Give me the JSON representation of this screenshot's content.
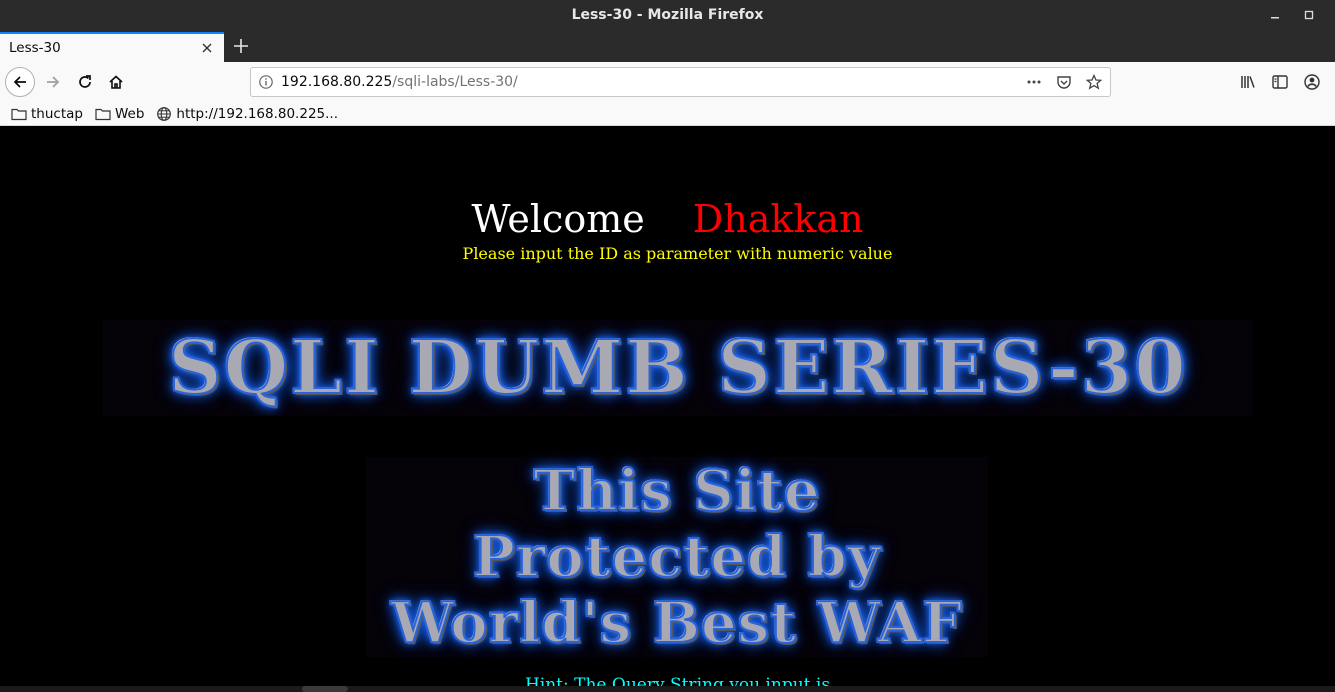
{
  "window": {
    "title": "Less-30 - Mozilla Firefox"
  },
  "tab": {
    "label": "Less-30"
  },
  "urlbar": {
    "host": "192.168.80.225",
    "path": "/sqli-labs/Less-30/"
  },
  "bookmarks": [
    {
      "label": "thuctap",
      "icon": "folder-icon"
    },
    {
      "label": "Web",
      "icon": "folder-icon"
    },
    {
      "label": "http://192.168.80.225...",
      "icon": "globe-icon"
    }
  ],
  "page": {
    "welcome": "Welcome",
    "name": "Dhakkan",
    "instruction": "Please input the ID as parameter with numeric value",
    "banner": "SQLI DUMB SERIES-30",
    "waf_line1": "This Site",
    "waf_line2": "Protected by",
    "waf_line3": "World's Best WAF",
    "hint": "Hint: The Query String you input is"
  },
  "colors": {
    "welcome": "#ffffff",
    "name": "#ff0000",
    "instruction": "#ffff00",
    "hint": "#00ffff",
    "accent": "#0a84ff"
  }
}
